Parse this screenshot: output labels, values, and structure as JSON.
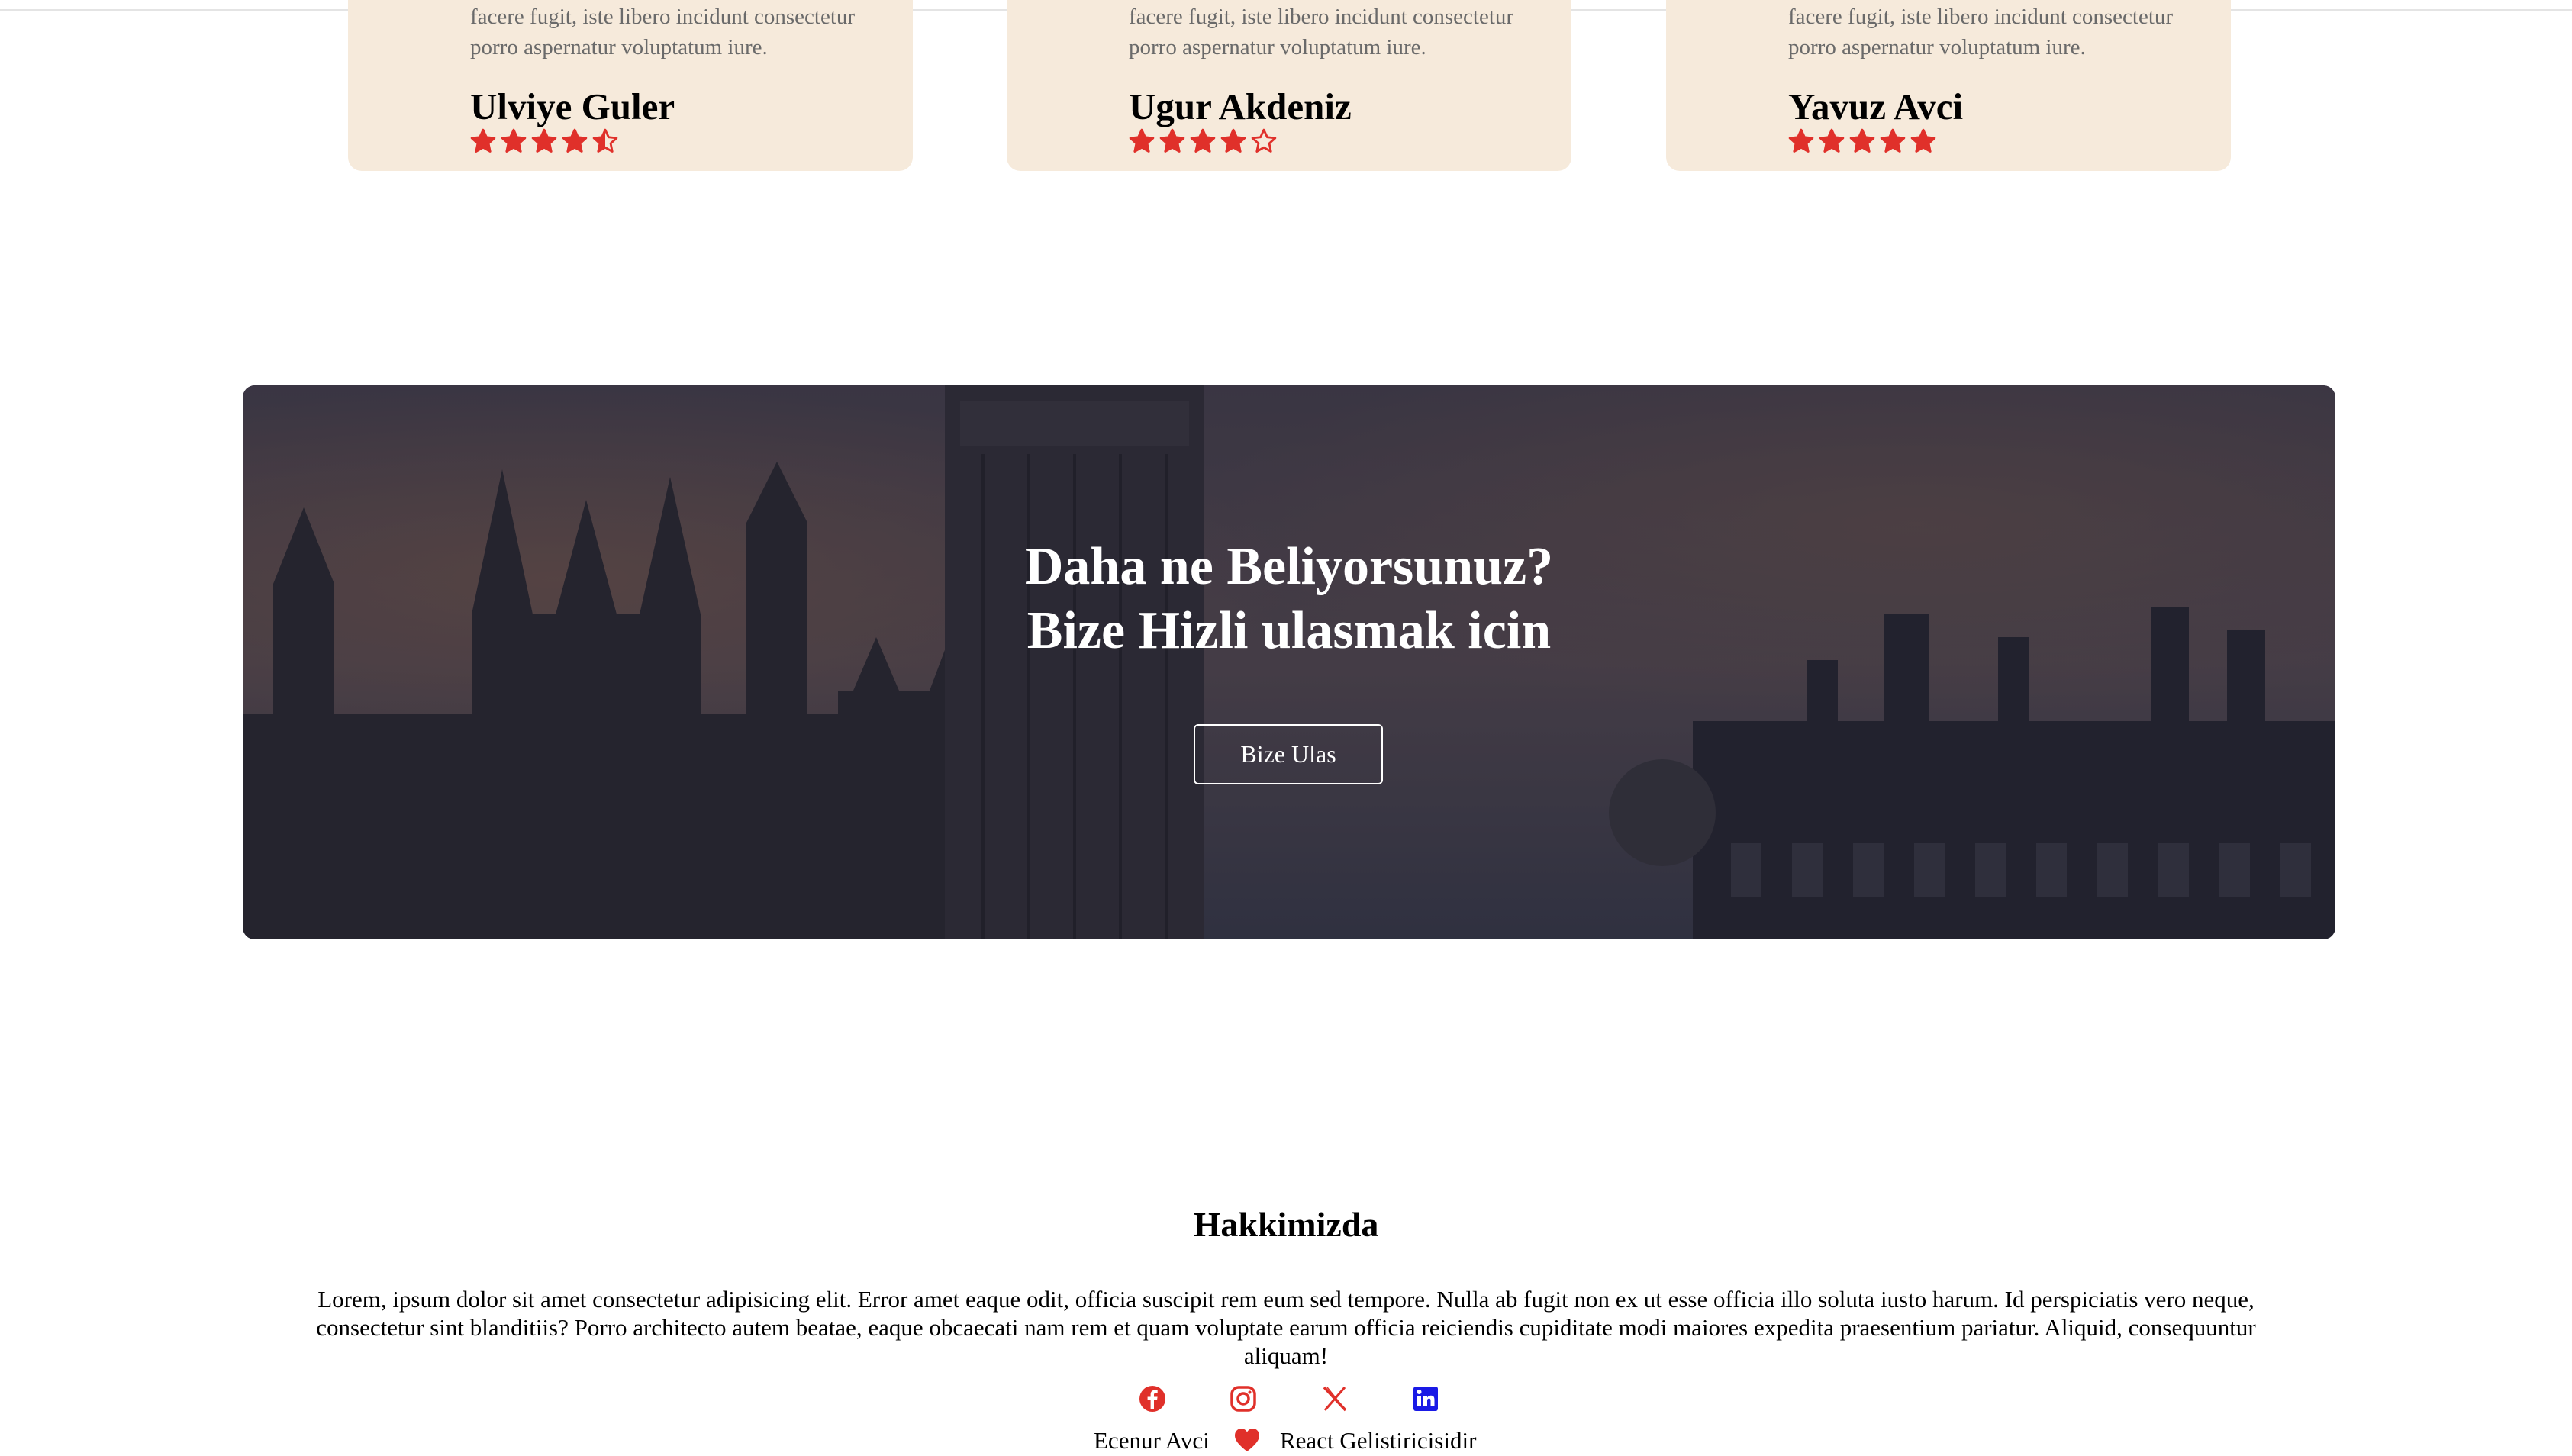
{
  "testimonials": [
    {
      "quote": "facere fugit, iste libero incidunt consectetur porro aspernatur voluptatum iure.",
      "name": "Ulviye Guler",
      "rating": 4.5
    },
    {
      "quote": "facere fugit, iste libero incidunt consectetur porro aspernatur voluptatum iure.",
      "name": "Ugur Akdeniz",
      "rating": 4
    },
    {
      "quote": "facere fugit, iste libero incidunt consectetur porro aspernatur voluptatum iure.",
      "name": "Yavuz Avci",
      "rating": 5
    }
  ],
  "cta_banner": {
    "title_line1": "Daha ne Beliyorsunuz?",
    "title_line2": "Bize Hizli ulasmak icin",
    "button_label": "Bize Ulas"
  },
  "about": {
    "title": "Hakkimizda",
    "text": "Lorem, ipsum dolor sit amet consectetur adipisicing elit. Error amet eaque odit, officia suscipit rem eum sed tempore. Nulla ab fugit non ex ut esse officia illo soluta iusto harum. Id perspiciatis vero neque, consectetur sint blanditiis? Porro architecto autem beatae, eaque obcaecati nam rem et quam voluptate earum officia reiciendis cupiditate modi maiores expedita praesentium pariatur. Aliquid, consequuntur aliquam!"
  },
  "socials": [
    {
      "icon": "facebook-icon",
      "color": "#e0302a"
    },
    {
      "icon": "instagram-icon",
      "color": "#e0302a"
    },
    {
      "icon": "x-twitter-icon",
      "color": "#e0302a"
    },
    {
      "icon": "linkedin-icon",
      "color": "#1a1ae6"
    }
  ],
  "footer": {
    "author": "Ecenur Avci",
    "heart_icon": "heart-icon",
    "role": "React Gelistiricisidir"
  },
  "colors": {
    "card_bg": "#f6eadb",
    "star": "#e0302a",
    "banner_overlay": "#3e3f4f"
  }
}
